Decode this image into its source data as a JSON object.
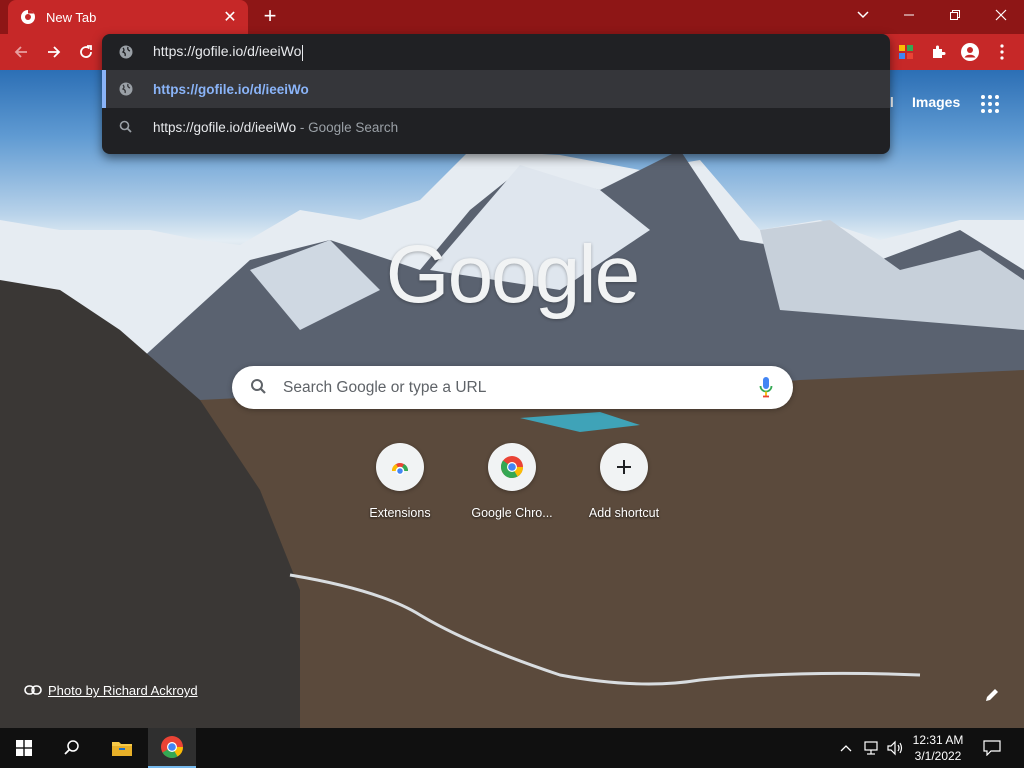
{
  "tab": {
    "title": "New Tab",
    "close": "✕"
  },
  "newtab": "+",
  "window": {
    "minimize": "─",
    "maximize": "❐",
    "close": "✕",
    "tabsearch": "⌄"
  },
  "omnibox": {
    "input": "https://gofile.io/d/ieeiWo",
    "suggestions": [
      {
        "text": "https://gofile.io/d/ieeiWo",
        "suffix": ""
      },
      {
        "text": "https://gofile.io/d/ieeiWo",
        "suffix": " - Google Search"
      }
    ]
  },
  "ntp": {
    "gmail_partial": "il",
    "images": "Images",
    "logo": "Google",
    "search_placeholder": "Search Google or type a URL",
    "shortcuts": [
      {
        "label": "Extensions",
        "icon": "extensions-icon"
      },
      {
        "label": "Google Chro...",
        "icon": "chrome-icon"
      },
      {
        "label": "Add shortcut",
        "icon": "plus-icon"
      }
    ],
    "photo_credit": "Photo by Richard Ackroyd"
  },
  "taskbar": {
    "time": "12:31 AM",
    "date": "3/1/2022"
  },
  "colors": {
    "tabstrip": "#8e1616",
    "toolbar": "#c62828",
    "omnibox_bg": "#202124",
    "link": "#8ab4f8"
  }
}
